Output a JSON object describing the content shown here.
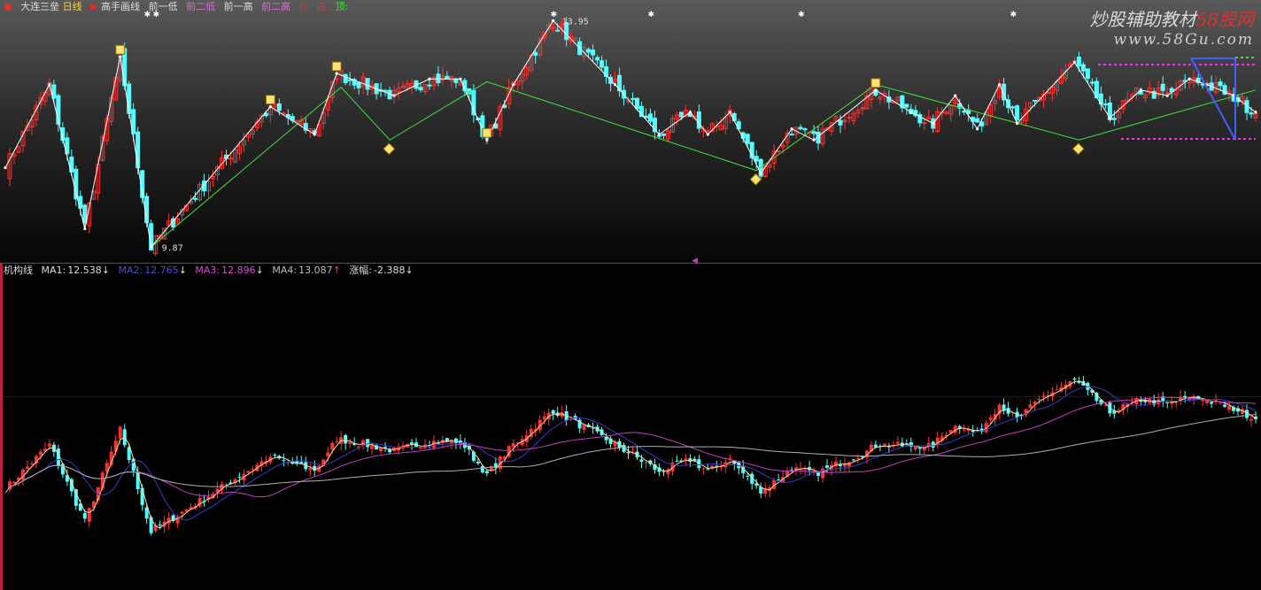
{
  "top_header": {
    "indicator": "大连三垒",
    "period": "日线",
    "tool": "高手画线",
    "prev_low": "前一低",
    "prev_low2": "前二低",
    "prev_high": "前一高",
    "prev_high2": "前二高",
    "ratio": "比",
    "bottom": "底",
    "top": "顶:"
  },
  "bottom_header": {
    "name": "机构线",
    "ma1_label": "MA1:",
    "ma1_value": "12.538",
    "ma2_label": "MA2:",
    "ma2_value": "12.765",
    "ma3_label": "MA3:",
    "ma3_value": "12.896",
    "ma4_label": "MA4:",
    "ma4_value": "13.087",
    "chg_label": "涨幅:",
    "chg_value": "-2.388"
  },
  "watermark": {
    "line1": "炒股辅助教材",
    "line1_brand": "58股网",
    "line2": "www.58Gu.com"
  },
  "annotations": {
    "high": "13.95",
    "low": "9.87"
  },
  "colors": {
    "up": "#ff3030",
    "down": "#54ffff",
    "zigzag": "#ffffff",
    "trend": "#40e040",
    "ma1": "#ffd8a0",
    "ma2": "#3a3acc",
    "ma3": "#c040c0",
    "ma4": "#b0b0b0"
  },
  "chart_data": {
    "type": "candlestick",
    "top_panel": {
      "zigzag_pivots": [
        {
          "i": 0,
          "v": 11.3
        },
        {
          "i": 10,
          "v": 12.8
        },
        {
          "i": 18,
          "v": 10.2
        },
        {
          "i": 26,
          "v": 13.3
        },
        {
          "i": 33,
          "v": 9.87
        },
        {
          "i": 60,
          "v": 12.4
        },
        {
          "i": 70,
          "v": 11.9
        },
        {
          "i": 75,
          "v": 13.0
        },
        {
          "i": 88,
          "v": 12.6
        },
        {
          "i": 96,
          "v": 12.9
        },
        {
          "i": 103,
          "v": 12.9
        },
        {
          "i": 109,
          "v": 11.8
        },
        {
          "i": 115,
          "v": 12.8
        },
        {
          "i": 124,
          "v": 13.95
        },
        {
          "i": 138,
          "v": 12.8
        },
        {
          "i": 148,
          "v": 11.9
        },
        {
          "i": 155,
          "v": 12.3
        },
        {
          "i": 159,
          "v": 11.9
        },
        {
          "i": 164,
          "v": 12.3
        },
        {
          "i": 171,
          "v": 11.2
        },
        {
          "i": 178,
          "v": 12.0
        },
        {
          "i": 183,
          "v": 11.8
        },
        {
          "i": 197,
          "v": 12.7
        },
        {
          "i": 205,
          "v": 12.3
        },
        {
          "i": 210,
          "v": 12.1
        },
        {
          "i": 215,
          "v": 12.6
        },
        {
          "i": 220,
          "v": 12.0
        },
        {
          "i": 225,
          "v": 12.8
        },
        {
          "i": 229,
          "v": 12.1
        },
        {
          "i": 242,
          "v": 13.2
        },
        {
          "i": 250,
          "v": 12.2
        },
        {
          "i": 257,
          "v": 12.7
        },
        {
          "i": 263,
          "v": 12.6
        },
        {
          "i": 268,
          "v": 12.9
        },
        {
          "i": 272,
          "v": 12.8
        },
        {
          "i": 278,
          "v": 12.6
        },
        {
          "i": 283,
          "v": 12.3
        }
      ],
      "trend_pivots": [
        {
          "i": 33,
          "v": 9.87
        },
        {
          "i": 76,
          "v": 12.75
        },
        {
          "i": 87,
          "v": 11.8
        },
        {
          "i": 109,
          "v": 12.85
        },
        {
          "i": 170,
          "v": 11.25
        },
        {
          "i": 197,
          "v": 12.8
        },
        {
          "i": 243,
          "v": 11.8
        },
        {
          "i": 283,
          "v": 12.7
        }
      ]
    },
    "bottom_panel": {
      "ma_series": [
        {
          "name": "MA1",
          "latest": 12.538
        },
        {
          "name": "MA2",
          "latest": 12.765
        },
        {
          "name": "MA3",
          "latest": 12.896
        },
        {
          "name": "MA4",
          "latest": 13.087
        }
      ],
      "bars": 284,
      "price_range": [
        9.5,
        15.2
      ]
    }
  }
}
